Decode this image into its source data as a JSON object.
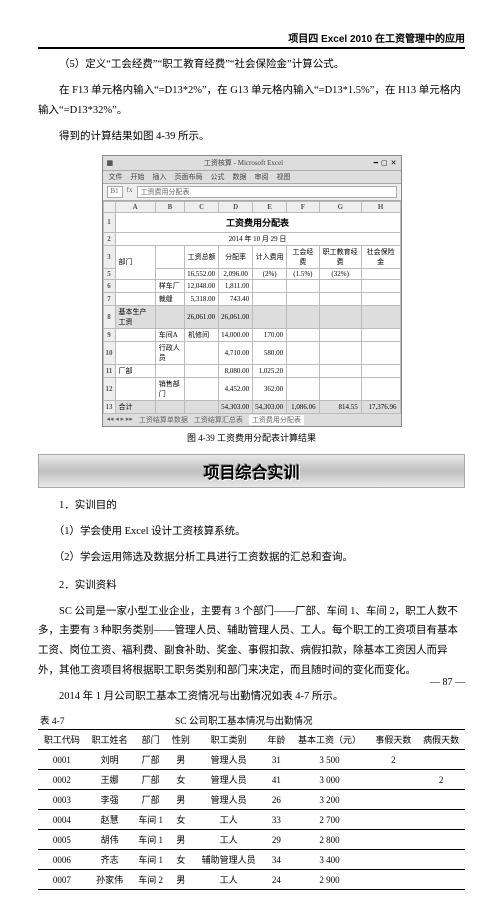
{
  "header": {
    "title": "项目四  Excel 2010 在工资管理中的应用"
  },
  "p1": "（5）定义“工会经费”“职工教育经费”“社会保险金”计算公式。",
  "p2": "在 F13 单元格内输入“=D13*2%”，在 G13 单元格内输入“=D13*1.5%”，在  H13 单元格内输入“=D13*32%”。",
  "p3": "得到的计算结果如图 4-39 所示。",
  "excel": {
    "appTitle": "工资核算 - Microsoft Excel",
    "menus": [
      "文件",
      "开始",
      "插入",
      "页面布局",
      "公式",
      "数据",
      "审阅",
      "视图"
    ],
    "cellRef": "B1",
    "formula": "工资费用分配表",
    "title": "工资费用分配表",
    "date": "2014 年 10 月 29 日",
    "cols": [
      "",
      "A",
      "B",
      "C",
      "D",
      "E",
      "F",
      "G",
      "H"
    ],
    "headerRow": [
      "",
      "部门",
      "",
      "工资总额",
      "分配率",
      "计入费用",
      "工会经费",
      "职工教育经费",
      "社会保险金"
    ],
    "rows": [
      [
        "5",
        "",
        "",
        "16,552.00",
        "2,096.00",
        "(2%)",
        "(1.5%)",
        "(32%)",
        ""
      ],
      [
        "6",
        "",
        "样车厂",
        "12,048.00",
        "1,811.00",
        "",
        "",
        "",
        ""
      ],
      [
        "7",
        "",
        "裁缝",
        "5,318.00",
        "743.40",
        "",
        "",
        "",
        ""
      ],
      [
        "8",
        "基本生产工资",
        "",
        "26,061.00",
        "26,061.00",
        "",
        "",
        "",
        ""
      ],
      [
        "9",
        "",
        "车间A",
        "机修间",
        "14,000.00",
        "170.00",
        "",
        "",
        ""
      ],
      [
        "10",
        "",
        "行政人员",
        "",
        "4,710.00",
        "580.00",
        "",
        "",
        ""
      ],
      [
        "11",
        "厂部",
        "",
        "",
        "8,080.00",
        "1,025.20",
        "",
        "",
        ""
      ],
      [
        "12",
        "",
        "销售部门",
        "",
        "4,452.00",
        "362.00",
        "",
        "",
        ""
      ],
      [
        "13",
        "合计",
        "",
        "",
        "54,303.00",
        "54,303.00",
        "1,086.06",
        "814.55",
        "17,376.96"
      ]
    ],
    "tabs": [
      "工资结算单数据",
      "工资结算汇总表",
      "工资费用分配表"
    ]
  },
  "figcap": "图 4-39  工资费用分配表计算结果",
  "bannerText": "项目综合实训",
  "s1": "1．实训目的",
  "s1a": "（1）学会使用 Excel 设计工资核算系统。",
  "s1b": "（2）学会运用筛选及数据分析工具进行工资数据的汇总和查询。",
  "s2": "2．实训资料",
  "s2a": "SC 公司是一家小型工业企业，主要有 3 个部门——厂部、车间 1、车间 2，职工人数不多，主要有 3 种职务类别——管理人员、辅助管理人员、工人。每个职工的工资项目有基本工资、岗位工资、福利费、副食补助、奖金、事假扣款、病假扣款，除基本工资因人而异外，其他工资项目将根据职工职务类别和部门来决定，而且随时间的变化而变化。",
  "s2b": "2014 年 1 月公司职工基本工资情况与出勤情况如表 4-7 所示。",
  "tableCap": {
    "left": "表 4-7",
    "right": "SC 公司职工基本情况与出勤情况"
  },
  "table": {
    "headers": [
      "职工代码",
      "职工姓名",
      "部门",
      "性别",
      "职工类别",
      "年龄",
      "基本工资（元）",
      "事假天数",
      "病假天数"
    ],
    "rows": [
      [
        "0001",
        "刘明",
        "厂部",
        "男",
        "管理人员",
        "31",
        "3 500",
        "2",
        ""
      ],
      [
        "0002",
        "王娜",
        "厂部",
        "女",
        "管理人员",
        "41",
        "3 000",
        "",
        "2"
      ],
      [
        "0003",
        "李强",
        "厂部",
        "男",
        "管理人员",
        "26",
        "3 200",
        "",
        ""
      ],
      [
        "0004",
        "赵慧",
        "车间 1",
        "女",
        "工人",
        "33",
        "2 700",
        "",
        ""
      ],
      [
        "0005",
        "胡伟",
        "车间 1",
        "男",
        "工人",
        "29",
        "2 800",
        "",
        ""
      ],
      [
        "0006",
        "齐志",
        "车间 1",
        "女",
        "辅助管理人员",
        "34",
        "3 400",
        "",
        ""
      ],
      [
        "0007",
        "孙家伟",
        "车间 2",
        "男",
        "工人",
        "24",
        "2 900",
        "",
        ""
      ]
    ]
  },
  "pageNum": "87"
}
